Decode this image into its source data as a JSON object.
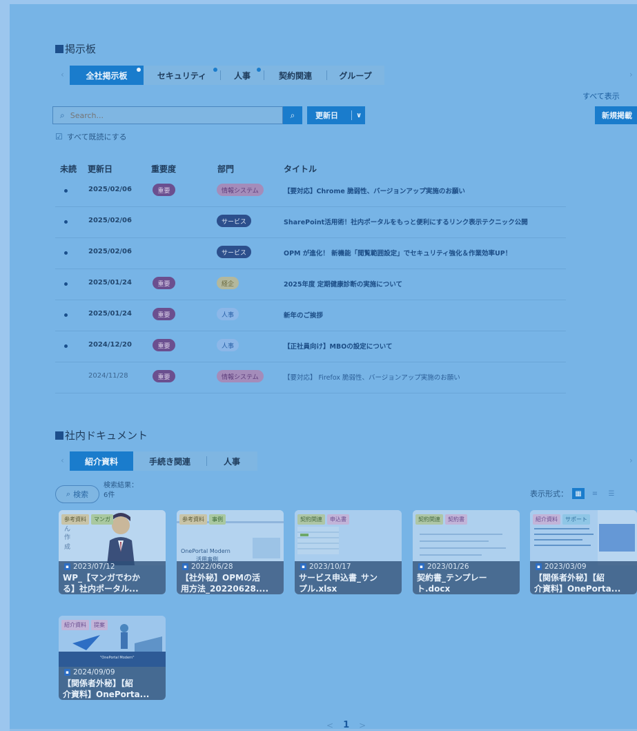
{
  "bulletin": {
    "heading": "掲示板",
    "tabs": [
      {
        "label": "全社掲示板",
        "active": true,
        "dot": true
      },
      {
        "label": "セキュリティ",
        "active": false,
        "dot": true
      },
      {
        "label": "人事",
        "active": false,
        "dot": true
      },
      {
        "label": "契約関連",
        "active": false,
        "dot": false
      },
      {
        "label": "グループ",
        "active": false,
        "dot": false
      }
    ],
    "see_all": "すべて表示",
    "search_placeholder": "Search...",
    "sort_label": "更新日",
    "new_post": "新規掲載",
    "mark_all_read": "すべて既読にする",
    "columns": {
      "unread": "未読",
      "date": "更新日",
      "importance": "重要度",
      "dept": "部門",
      "title": "タイトル"
    },
    "rows": [
      {
        "unread": true,
        "date": "2025/02/06",
        "importance": "重要",
        "dept": "情報システム",
        "dept_style": "sys",
        "title": "【要対応】Chrome 脆弱性、バージョンアップ実施のお願い"
      },
      {
        "unread": true,
        "date": "2025/02/06",
        "importance": "",
        "dept": "サービス",
        "dept_style": "svc",
        "title": "SharePoint活用術！社内ポータルをもっと便利にするリンク表示テクニック公開"
      },
      {
        "unread": true,
        "date": "2025/02/06",
        "importance": "",
        "dept": "サービス",
        "dept_style": "svc",
        "title": "OPM が進化！ 新機能「閲覧範囲設定」でセキュリティ強化＆作業効率UP！"
      },
      {
        "unread": true,
        "date": "2025/01/24",
        "importance": "重要",
        "dept": "経企",
        "dept_style": "plan",
        "title": "2025年度 定期健康診断の実施について"
      },
      {
        "unread": true,
        "date": "2025/01/24",
        "importance": "重要",
        "dept": "人事",
        "dept_style": "hr",
        "title": "新年のご挨拶"
      },
      {
        "unread": true,
        "date": "2024/12/20",
        "importance": "重要",
        "dept": "人事",
        "dept_style": "hr",
        "title": "【正社員向け】MBOの設定について"
      },
      {
        "unread": false,
        "date": "2024/11/28",
        "importance": "重要",
        "dept": "情報システム",
        "dept_style": "sys",
        "title": "【要対応】 Firefox 脆弱性、バージョンアップ実施のお願い"
      }
    ]
  },
  "documents": {
    "heading": "社内ドキュメント",
    "tabs": [
      {
        "label": "紹介資料",
        "active": true
      },
      {
        "label": "手続き関連",
        "active": false
      },
      {
        "label": "人事",
        "active": false
      }
    ],
    "search_label": "検索",
    "result_label": "検索結果：",
    "result_count": "6件",
    "view_mode_label": "表示形式：",
    "cards": [
      {
        "tags": [
          "参考資料",
          "マンガ"
        ],
        "tag_styles": [
          "ref",
          "manga"
        ],
        "date": "2023/07/12",
        "title": "WP_【マンガでわか\nる】社内ポータル..."
      },
      {
        "tags": [
          "参考資料",
          "事例"
        ],
        "tag_styles": [
          "ref",
          "ex"
        ],
        "date": "2022/06/28",
        "title": "【社外秘】OPMの活\n用方法_20220628...."
      },
      {
        "tags": [
          "契約関連",
          "申込書"
        ],
        "tag_styles": [
          "contract",
          "form"
        ],
        "date": "2023/10/17",
        "title": "サービス申込書_サン\nプル.xlsx"
      },
      {
        "tags": [
          "契約関連",
          "契約書"
        ],
        "tag_styles": [
          "contract",
          "tmpl"
        ],
        "date": "2023/01/26",
        "title": "契約書_テンプレー\nト.docx"
      },
      {
        "tags": [
          "紹介資料",
          "サポート"
        ],
        "tag_styles": [
          "intro",
          "support"
        ],
        "date": "2023/03/09",
        "title": "【関係者外秘】【紹\n介資料】OnePorta..."
      },
      {
        "tags": [
          "紹介資料",
          "提案"
        ],
        "tag_styles": [
          "intro",
          "proposal"
        ],
        "date": "2024/09/09",
        "title": "【関係者外秘】【紹\n介資料】OnePorta..."
      }
    ],
    "thumb_texts": {
      "card1": "OnePortal Modern",
      "card1_sub": "活用事例"
    },
    "pager": {
      "prev": "<",
      "current": "1",
      "next": ">"
    }
  }
}
